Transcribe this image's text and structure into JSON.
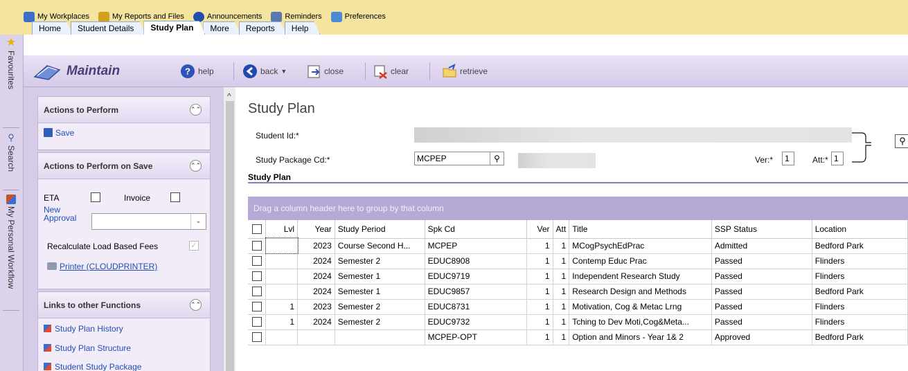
{
  "topmenu": [
    {
      "label": "My Workplaces",
      "icon": "workplaces-icon",
      "color": "#3b6fc8"
    },
    {
      "label": "My Reports and Files",
      "icon": "reports-files-icon",
      "color": "#d4a019"
    },
    {
      "label": "Announcements",
      "icon": "announcements-icon",
      "color": "#1f4fa8"
    },
    {
      "label": "Reminders",
      "icon": "reminders-icon",
      "color": "#5a78b0"
    },
    {
      "label": "Preferences",
      "icon": "preferences-icon",
      "color": "#4b8bd6"
    }
  ],
  "tabs": [
    "Home",
    "Student Details",
    "Study Plan",
    "More",
    "Reports",
    "Help"
  ],
  "vstrip": {
    "favourites": "Favourites",
    "search": "Search",
    "workflow": "My Personal Workflow"
  },
  "maintain": {
    "title": "Maintain",
    "help": "help",
    "back": "back",
    "close": "close",
    "clear": "clear",
    "retrieve": "retrieve"
  },
  "actions": {
    "title": "Actions to Perform",
    "save": "Save"
  },
  "actions_on_save": {
    "title": "Actions to Perform on Save",
    "eta": "ETA",
    "invoice": "Invoice",
    "new_approval": "New Approval",
    "recalc": "Recalculate Load Based Fees",
    "printer": "Printer (CLOUDPRINTER)"
  },
  "links": {
    "title": "Links to other Functions",
    "items": [
      "Study Plan History",
      "Study Plan Structure",
      "Student Study Package"
    ]
  },
  "form": {
    "page_title": "Study Plan",
    "student_id_label": "Student Id:*",
    "spk_label": "Study Package Cd:*",
    "spk_value": "MCPEP",
    "ver_label": "Ver:*",
    "ver_value": "1",
    "att_label": "Att:*",
    "att_value": "1",
    "section_label": "Study Plan"
  },
  "grid": {
    "group_hint": "Drag a column header here to group by that column",
    "columns": [
      "",
      "Lvl",
      "Year",
      "Study Period",
      "Spk Cd",
      "Ver",
      "Att",
      "Title",
      "SSP Status",
      "Location"
    ],
    "rows": [
      {
        "lvl": "",
        "year": "2023",
        "period": "Course Second H...",
        "spk": "MCPEP",
        "ver": "1",
        "att": "1",
        "title": "MCogPsychEdPrac",
        "status": "Admitted",
        "location": "Bedford Park"
      },
      {
        "lvl": "",
        "year": "2024",
        "period": "Semester 2",
        "spk": "EDUC8908",
        "ver": "1",
        "att": "1",
        "title": "Contemp Educ Prac",
        "status": "Passed",
        "location": "Flinders"
      },
      {
        "lvl": "",
        "year": "2024",
        "period": "Semester 1",
        "spk": "EDUC9719",
        "ver": "1",
        "att": "1",
        "title": "Independent Research Study",
        "status": "Passed",
        "location": "Flinders"
      },
      {
        "lvl": "",
        "year": "2024",
        "period": "Semester 1",
        "spk": "EDUC9857",
        "ver": "1",
        "att": "1",
        "title": "Research Design and Methods",
        "status": "Passed",
        "location": "Bedford Park"
      },
      {
        "lvl": "1",
        "year": "2023",
        "period": "Semester 2",
        "spk": "EDUC8731",
        "ver": "1",
        "att": "1",
        "title": "Motivation, Cog & Metac Lrng",
        "status": "Passed",
        "location": "Flinders"
      },
      {
        "lvl": "1",
        "year": "2024",
        "period": "Semester 2",
        "spk": "EDUC9732",
        "ver": "1",
        "att": "1",
        "title": "Tching to Dev Moti,Cog&Meta...",
        "status": "Passed",
        "location": "Flinders"
      },
      {
        "lvl": "",
        "year": "",
        "period": "",
        "spk": "MCPEP-OPT",
        "ver": "1",
        "att": "1",
        "title": "Option and Minors - Year 1& 2",
        "status": "Approved",
        "location": "Bedford Park"
      }
    ]
  }
}
